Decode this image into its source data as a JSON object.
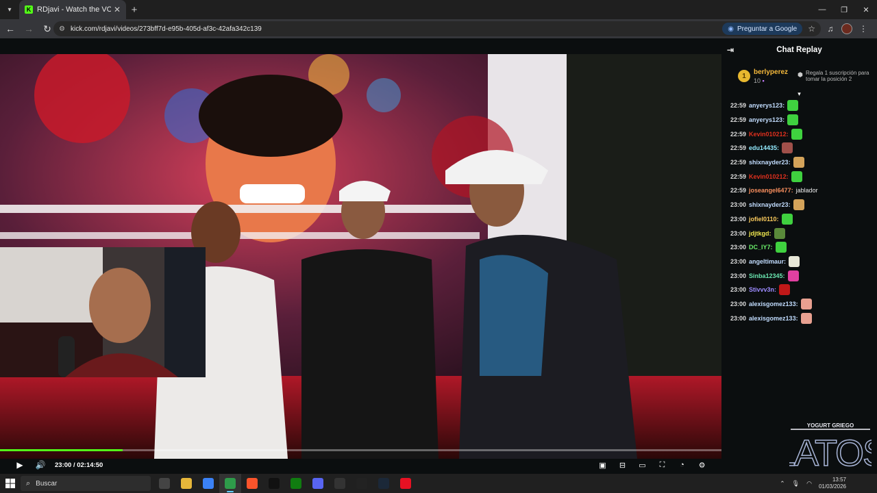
{
  "browser": {
    "tab_title": "RDjavi - Watch the VOD on Kick",
    "tab_favicon": "K",
    "url": "kick.com/rdjavi/videos/273bff7d-e95b-405d-af3c-42afa342c139",
    "google_button": "Preguntar a Google",
    "icons": [
      "tab-search-icon",
      "back-icon",
      "forward-icon",
      "reload-icon",
      "site-info-icon",
      "star-icon",
      "media-icon",
      "profile-avatar",
      "more-icon"
    ]
  },
  "player": {
    "current_time": "23:00",
    "separator": " / ",
    "duration": "02:14:50",
    "progress": 0.17,
    "progress_color": "#53fc18",
    "icons": [
      "play-icon",
      "volume-icon",
      "miniplayer-icon",
      "theater-icon",
      "cinema-icon",
      "fullscreen-icon",
      "clip-icon",
      "settings-icon"
    ]
  },
  "chat": {
    "title": "Chat Replay",
    "pinned": {
      "rank": "1",
      "username": "berlyperez",
      "count": "10",
      "gift_text": "Regala 1 suscripción para tomar la posición 2"
    },
    "messages": [
      {
        "ts": "22:59",
        "user": "anyerys123:",
        "color": "#c2ddff",
        "text": "",
        "emote": "#3fd13f"
      },
      {
        "ts": "22:59",
        "user": "anyerys123:",
        "color": "#c2ddff",
        "text": "",
        "emote": "#3fd13f"
      },
      {
        "ts": "22:59",
        "user": "Kevin010212:",
        "color": "#e0301e",
        "text": "",
        "emote": "#3fd13f"
      },
      {
        "ts": "22:59",
        "user": "edu14435:",
        "color": "#93ebff",
        "text": "",
        "emote": "#a0504a"
      },
      {
        "ts": "22:59",
        "user": "shixnayder23:",
        "color": "#c2ddff",
        "text": "",
        "emote": "#d4a35a"
      },
      {
        "ts": "22:59",
        "user": "Kevin010212:",
        "color": "#e0301e",
        "text": "",
        "emote": "#3fd13f"
      },
      {
        "ts": "22:59",
        "user": "joseangel6477:",
        "color": "#f98f5e",
        "text": "jablador",
        "emote": ""
      },
      {
        "ts": "23:00",
        "user": "shixnayder23:",
        "color": "#c2ddff",
        "text": "",
        "emote": "#d4a35a"
      },
      {
        "ts": "23:00",
        "user": "jofiel0110:",
        "color": "#fbcb5d",
        "text": "",
        "emote": "#3fd13f"
      },
      {
        "ts": "23:00",
        "user": "jdjtkgd:",
        "color": "#f0e84f",
        "text": "",
        "emote": "#5a8a3a"
      },
      {
        "ts": "23:00",
        "user": "DC_IY7:",
        "color": "#6aef6a",
        "text": "",
        "emote": "#3fd13f"
      },
      {
        "ts": "23:00",
        "user": "angeltimaur:",
        "color": "#c2ddff",
        "text": "",
        "emote": "#e8e8d8"
      },
      {
        "ts": "23:00",
        "user": "Sinba12345:",
        "color": "#6ae6b0",
        "text": "",
        "emote": "#e040a0"
      },
      {
        "ts": "23:00",
        "user": "Stivvv3n:",
        "color": "#9d8bff",
        "text": "",
        "emote": "#c01818"
      },
      {
        "ts": "23:00",
        "user": "alexisgomez133:",
        "color": "#c2ddff",
        "text": "",
        "emote": "#e8a090"
      },
      {
        "ts": "23:00",
        "user": "alexisgomez133:",
        "color": "#c2ddff",
        "text": "",
        "emote": "#e8a090"
      }
    ],
    "sponsor_logo": {
      "top": "YOGURT GRIEGO",
      "main": "LATOS"
    }
  },
  "taskbar": {
    "search_placeholder": "Buscar",
    "date": "01/03/2026",
    "time": "13:57",
    "apps": [
      {
        "name": "task-view-icon",
        "color": "#444"
      },
      {
        "name": "file-explorer-icon",
        "color": "#e7b73a"
      },
      {
        "name": "store-icon",
        "color": "#3b82f6"
      },
      {
        "name": "chrome-icon",
        "color": "#2e9b4a"
      },
      {
        "name": "brave-icon",
        "color": "#fb542b"
      },
      {
        "name": "capcut-icon",
        "color": "#111"
      },
      {
        "name": "xbox-icon",
        "color": "#107c10"
      },
      {
        "name": "discord-icon",
        "color": "#5865f2"
      },
      {
        "name": "obs-icon",
        "color": "#333"
      },
      {
        "name": "davinci-icon",
        "color": "#222"
      },
      {
        "name": "steam-icon",
        "color": "#1b2838"
      },
      {
        "name": "recorder-icon",
        "color": "#e81123"
      }
    ]
  }
}
